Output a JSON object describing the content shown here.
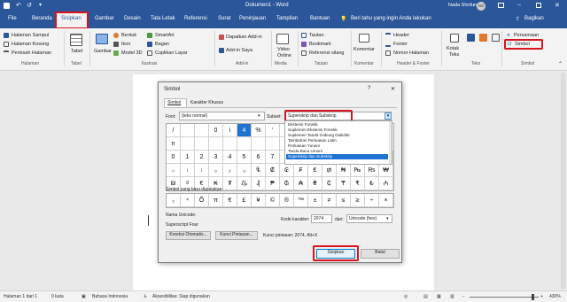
{
  "window": {
    "title": "Dokumen1 - Word",
    "user": "Nada Shofura",
    "initials": "NS"
  },
  "tabs": [
    "File",
    "Beranda",
    "Sisipkan",
    "Gambar",
    "Desain",
    "Tata Letak",
    "Referensi",
    "Surat",
    "Peninjauan",
    "Tampilan",
    "Bantuan"
  ],
  "tell_me": "Beri tahu yang ingin Anda lakukan",
  "share": "Bagikan",
  "ribbon": {
    "halaman": [
      "Halaman Sampul",
      "Halaman Kosong",
      "Pemisah Halaman"
    ],
    "tabel": "Tabel",
    "gambar": "Gambar",
    "ilustrasi": [
      "Bentuk",
      "Ikon",
      "Model 3D"
    ],
    "ilustrasi2": [
      "SmartArt",
      "Bagan",
      "Cuplikan Layar"
    ],
    "addin": [
      "Dapatkan Add-in",
      "Add-in Saya"
    ],
    "video": [
      "Video",
      "Online"
    ],
    "link": [
      "Tautan",
      "Bookmark",
      "Referensi silang"
    ],
    "komentar": "Komentar",
    "header": [
      "Header",
      "Footer",
      "Nomor Halaman"
    ],
    "teks": [
      "Kotak",
      "Teks"
    ],
    "simbol": [
      "Persamaan",
      "Simbol"
    ],
    "groups": [
      "Halaman",
      "Tabel",
      "Ilustrasi",
      "Add-in",
      "Media",
      "Tautan",
      "Komentar",
      "Header & Footer",
      "Teks",
      "Simbol"
    ]
  },
  "dialog": {
    "title": "Simbol",
    "help": "?",
    "close": "✕",
    "tabs": [
      "Simbol",
      "Karakter Khusus"
    ],
    "font_label": "Font:",
    "font_value": "(teks normal)",
    "subset_label": "Subset:",
    "subset_value": "Superskrip dan Subskrip",
    "subset_list": [
      "Ekstensi Fonetik",
      "Suplemen Ekstensi Fonetik",
      "Suplemen Tanda Gabung Diakritik",
      "Tambahan Perluasan Latin",
      "Perluasan Yunani",
      "Tanda Baca Umum",
      "Superskrip dan Subskrip"
    ],
    "grid": [
      [
        "/",
        "",
        "",
        "0",
        "i",
        "4",
        "%",
        "'",
        ""
      ],
      [
        "n",
        "",
        "",
        "",
        "",
        "",
        "",
        "",
        ""
      ],
      [
        "0",
        "1",
        "2",
        "3",
        "4",
        "5",
        "6",
        "7",
        "8",
        "9"
      ],
      [
        "₎",
        "ₐ",
        "ₑ",
        "ₒ",
        "ₓ",
        "ₔ",
        "ₕ",
        "ₖ",
        "ₗ",
        "ₘ",
        "ₙ",
        "ₚ",
        "ₛ",
        "ₜ",
        "₠",
        "₡",
        "₢",
        "₣",
        "₤",
        "₥"
      ],
      [
        "₦",
        "₧",
        "₨",
        "₩",
        "₪",
        "₫",
        "€",
        "₭",
        "₮",
        "₯",
        "₰",
        "₱",
        "₲",
        "₳",
        "₴",
        "₵",
        "₸",
        "₹"
      ]
    ],
    "row0": [
      "/",
      "",
      "",
      "0",
      "i",
      "4",
      "%",
      "'",
      ""
    ],
    "row1": [
      "n",
      "",
      "",
      "",
      "",
      "",
      "",
      "",
      "",
      ""
    ],
    "row2": [
      "0",
      "1",
      "2",
      "3",
      "4",
      "5",
      "6",
      "7",
      "8",
      "9",
      "+",
      "−",
      "=",
      "(",
      ")",
      "ⁿ"
    ],
    "row3": [
      "₌",
      "₍",
      "₎",
      "₀",
      "₂",
      "₃",
      "₠",
      "₡",
      "₢",
      "₣",
      "₤",
      "₥",
      "₦",
      "₧",
      "₨",
      "₩"
    ],
    "row4": [
      "₪",
      "₫",
      "€",
      "₭",
      "₮",
      "₯",
      "₰",
      "₱",
      "₲",
      "₳",
      "₴",
      "₵",
      "₸",
      "₹",
      "₺",
      "₼"
    ],
    "recent_label": "Simbol yang baru digunakan:",
    "recent": [
      "₂",
      "⁴",
      "Õ",
      "π",
      "€",
      "£",
      "¥",
      "©",
      "®",
      "™",
      "±",
      "≠",
      "≤",
      "≥",
      "÷",
      "×"
    ],
    "unicode_name_label": "Nama Unicode:",
    "unicode_name": "Superscript Four",
    "charcode_label": "Kode karakter:",
    "charcode": "2074",
    "from_label": "dari:",
    "from_value": "Unicode (hex)",
    "autocorrect": "Koreksi Otomatis...",
    "shortcut_btn": "Kunci Pintasan...",
    "shortcut_text": "Kunci pintasan: 2074, Alt+X",
    "insert": "Sisipkan",
    "cancel": "Batal"
  },
  "status": {
    "page": "Halaman 1 dari 1",
    "words": "0 kata",
    "lang": "Bahasa Indonesia",
    "access": "Aksesibilitas: Siap digunakan",
    "zoom": "430%"
  }
}
